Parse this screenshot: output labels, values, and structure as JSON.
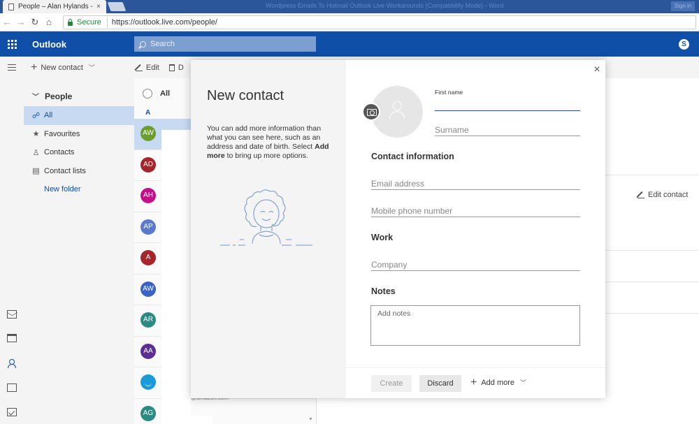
{
  "browser": {
    "tab_title": "People – Alan Hylands - O",
    "tab_close": "×",
    "background_title": "Wordpress Emails To Hotmail Outlook Live Workarounds (Compatibility Mode) - Word",
    "signin": "Sign in",
    "secure_label": "Secure",
    "url": "https://outlook.live.com/people/"
  },
  "header": {
    "brand": "Outlook",
    "search_placeholder": "Search"
  },
  "commands": {
    "new_contact": "New contact",
    "edit": "Edit",
    "delete_partial": "D"
  },
  "folders": {
    "header": "People",
    "items": [
      {
        "label": "All",
        "icon": "people-icon",
        "selected": true
      },
      {
        "label": "Favourites",
        "icon": "star-icon"
      },
      {
        "label": "Contacts",
        "icon": "person-icon"
      },
      {
        "label": "Contact lists",
        "icon": "list-icon"
      }
    ],
    "new_folder": "New folder"
  },
  "contact_list": {
    "select_all_label": "All",
    "letter_header": "A",
    "rows": [
      {
        "initials": "AW",
        "color": "#6b9e2f",
        "selected": true
      },
      {
        "initials": "AD",
        "color": "#a4262c"
      },
      {
        "initials": "AH",
        "color": "#c30f8a"
      },
      {
        "initials": "AP",
        "color": "#5a7ac9"
      },
      {
        "initials": "A",
        "color": "#a4262c"
      },
      {
        "initials": "AW",
        "color": "#3a63c7"
      },
      {
        "initials": "AR",
        "color": "#2b8a82"
      },
      {
        "initials": "AA",
        "color": "#5c2e91"
      },
      {
        "initials": "",
        "color": "#1a9bd7",
        "amazon": true
      },
      {
        "initials": "AG",
        "color": "#2b8a82"
      }
    ],
    "partial_email": "@amazon.com"
  },
  "reading_pane": {
    "edit_contact": "Edit contact"
  },
  "modal": {
    "title": "New contact",
    "desc_1": "You can add more information than what you can see here, such as an address and date of birth. Select ",
    "desc_bold": "Add more",
    "desc_2": " to bring up more options.",
    "first_name_label": "First name",
    "first_name_value": "",
    "surname_placeholder": "Surname",
    "contact_info_header": "Contact information",
    "email_placeholder": "Email address",
    "mobile_placeholder": "Mobile phone number",
    "work_header": "Work",
    "company_placeholder": "Company",
    "notes_header": "Notes",
    "notes_placeholder": "Add notes",
    "create_label": "Create",
    "discard_label": "Discard",
    "add_more_label": "Add more",
    "close_glyph": "×"
  }
}
